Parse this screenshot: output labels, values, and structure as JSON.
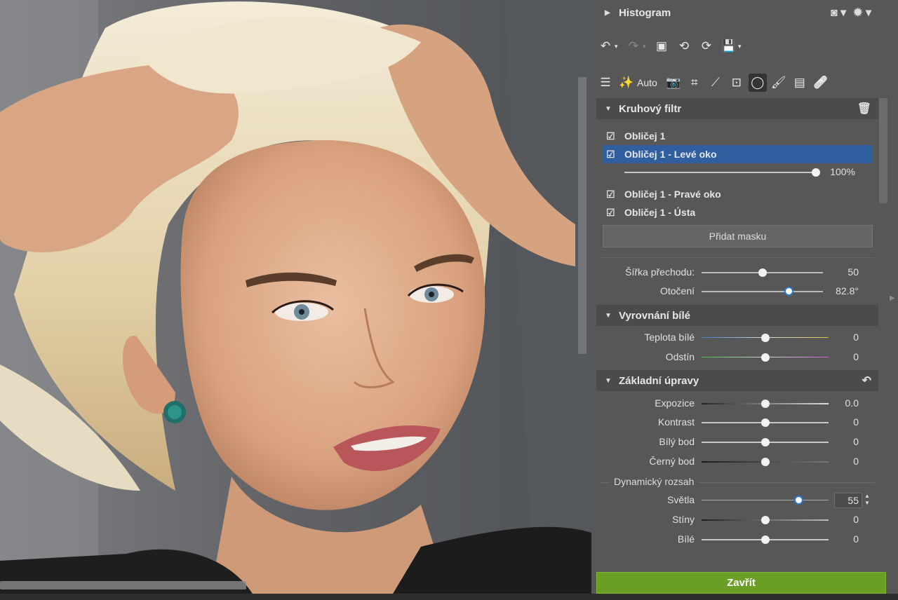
{
  "histogram": {
    "title": "Histogram"
  },
  "tools": {
    "auto_label": "Auto"
  },
  "radial_filter": {
    "title": "Kruhový filtr",
    "masks": [
      {
        "label": "Obličej 1",
        "checked": true,
        "selected": false
      },
      {
        "label": "Obličej 1 - Levé oko",
        "checked": true,
        "selected": true
      },
      {
        "label": "Obličej 1 - Pravé oko",
        "checked": true,
        "selected": false
      },
      {
        "label": "Obličej 1 - Ústa",
        "checked": true,
        "selected": false
      }
    ],
    "opacity": {
      "value": "100%",
      "level": 1.0
    },
    "add_mask": "Přidat masku",
    "sliders": [
      {
        "label": "Šířka přechodu:",
        "value": "50",
        "level": 0.5
      },
      {
        "label": "Otočení",
        "value": "82.8°",
        "level": 0.72
      }
    ]
  },
  "white_balance": {
    "title": "Vyrovnání bílé",
    "sliders": [
      {
        "label": "Teplota bílé",
        "value": "0",
        "level": 0.5
      },
      {
        "label": "Odstín",
        "value": "0",
        "level": 0.5
      }
    ]
  },
  "basic": {
    "title": "Základní úpravy",
    "sliders": [
      {
        "label": "Expozice",
        "value": "0.0",
        "level": 0.5
      },
      {
        "label": "Kontrast",
        "value": "0",
        "level": 0.5
      },
      {
        "label": "Bílý bod",
        "value": "0",
        "level": 0.5
      },
      {
        "label": "Černý bod",
        "value": "0",
        "level": 0.5
      }
    ],
    "dynamic_range_title": "Dynamický rozsah",
    "dynamic": [
      {
        "label": "Světla",
        "value": "55",
        "level": 0.775
      },
      {
        "label": "Stíny",
        "value": "0",
        "level": 0.5
      },
      {
        "label": "Bílé",
        "value": "0",
        "level": 0.5
      }
    ]
  },
  "close_button": "Zavřít",
  "colors": {
    "selected_row": "#2f5f9f",
    "close_green": "#6b9e24",
    "panel_bg": "#575757",
    "header_bg": "#4b4b4b"
  }
}
